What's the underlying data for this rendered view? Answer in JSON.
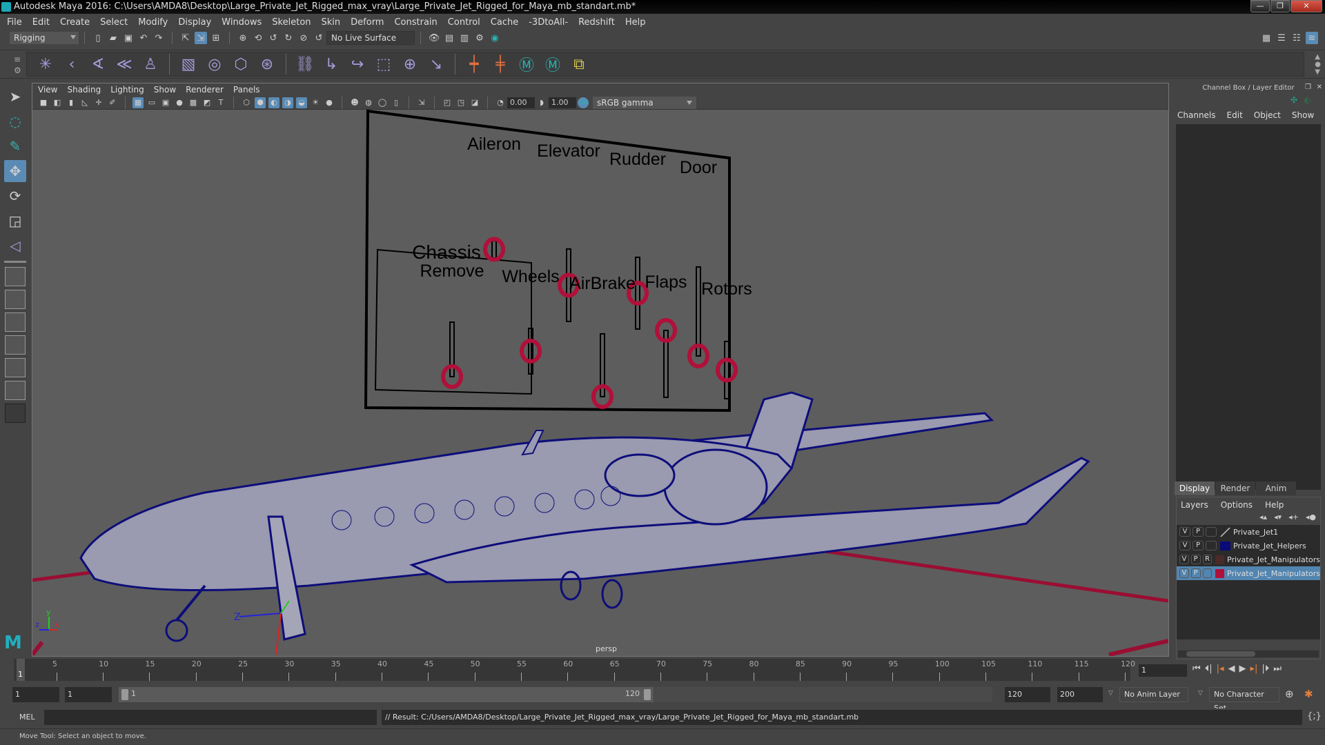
{
  "window": {
    "title": "Autodesk Maya 2016: C:\\Users\\AMDA8\\Desktop\\Large_Private_Jet_Rigged_max_vray\\Large_Private_Jet_Rigged_for_Maya_mb_standart.mb*",
    "minimize": "—",
    "restore": "❐",
    "close": "✕"
  },
  "menubar": [
    "File",
    "Edit",
    "Create",
    "Select",
    "Modify",
    "Display",
    "Windows",
    "Skeleton",
    "Skin",
    "Deform",
    "Constrain",
    "Control",
    "Cache",
    "-3DtoAll-",
    "Redshift",
    "Help"
  ],
  "statusline": {
    "menuset": "Rigging",
    "live_surface": "No Live Surface"
  },
  "viewport": {
    "menu": [
      "View",
      "Shading",
      "Lighting",
      "Show",
      "Renderer",
      "Panels"
    ],
    "exposure": "0.00",
    "gamma_value": "1.00",
    "color_space": "sRGB gamma",
    "camera_label": "persp",
    "axis_labels": {
      "x": "x",
      "y": "y",
      "z": "z"
    },
    "control_panel": {
      "top_sliders": [
        {
          "label": "Aileron",
          "value": 0.5
        },
        {
          "label": "Elevator",
          "value": 0.5
        },
        {
          "label": "Rudder",
          "value": 0.5
        },
        {
          "label": "Door",
          "value": 0.0
        }
      ],
      "chassis_group_label": "Chassis",
      "chassis_sliders": [
        {
          "label": "Remove",
          "value": 0.0
        },
        {
          "label": "Wheels",
          "value": 0.5
        }
      ],
      "bottom_sliders": [
        {
          "label": "AirBrake",
          "value": 0.0
        },
        {
          "label": "Flaps",
          "value": 1.0
        },
        {
          "label": "Rotors",
          "value": 0.5
        }
      ]
    },
    "colors": {
      "wireframe": "#0d0d7a",
      "manipulator": "#b0103a",
      "grid_axis": "#9a0e33"
    }
  },
  "channel_box": {
    "title": "Channel Box / Layer Editor",
    "menu": [
      "Channels",
      "Edit",
      "Object",
      "Show"
    ]
  },
  "layer_editor": {
    "tabs": [
      "Display",
      "Render",
      "Anim"
    ],
    "active_tab": "Display",
    "menu": [
      "Layers",
      "Options",
      "Help"
    ],
    "layers": [
      {
        "v": "V",
        "p": "P",
        "r": "",
        "color": "none",
        "name": "Private_Jet1",
        "selected": false
      },
      {
        "v": "V",
        "p": "P",
        "r": "",
        "color": "#0a0a7a",
        "name": "Private_Jet_Helpers",
        "selected": false
      },
      {
        "v": "V",
        "p": "P",
        "r": "R",
        "color": "#4a2a28",
        "name": "Private_Jet_Manipulators",
        "selected": false
      },
      {
        "v": "V",
        "p": "P",
        "r": "",
        "color": "#b0103a",
        "name": "Private_Jet_Manipulators",
        "selected": true
      }
    ]
  },
  "timeline": {
    "ticks": [
      "5",
      "10",
      "15",
      "20",
      "25",
      "30",
      "35",
      "40",
      "45",
      "50",
      "55",
      "60",
      "65",
      "70",
      "75",
      "80",
      "85",
      "90",
      "95",
      "100",
      "105",
      "110",
      "115",
      "120"
    ],
    "current_marker": "1",
    "current_frame": "1"
  },
  "range": {
    "start": "1",
    "playback_start": "1",
    "slider_start": "1",
    "slider_end": "120",
    "playback_end": "120",
    "end": "200",
    "anim_layer": "No Anim Layer",
    "character_set": "No Character Set"
  },
  "command_line": {
    "language": "MEL",
    "input": "",
    "result": "// Result: C:/Users/AMDA8/Desktop/Large_Private_Jet_Rigged_max_vray/Large_Private_Jet_Rigged_for_Maya_mb_standart.mb"
  },
  "help_line": "Move Tool: Select an object to move."
}
